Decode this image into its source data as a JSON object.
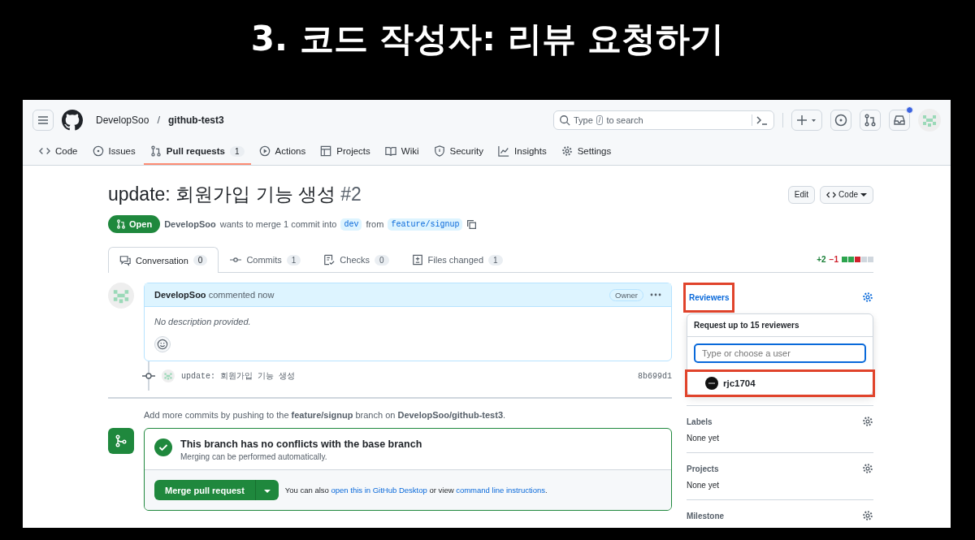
{
  "slide_title": "3. 코드 작성자: 리뷰 요청하기",
  "header": {
    "owner": "DevelopSoo",
    "separator": "/",
    "repo": "github-test3",
    "search_before": "Type",
    "search_key": "/",
    "search_after": "to search",
    "unread": true
  },
  "repo_tabs": [
    {
      "label": "Code",
      "selected": false
    },
    {
      "label": "Issues",
      "selected": false
    },
    {
      "label": "Pull requests",
      "count": "1",
      "selected": true
    },
    {
      "label": "Actions",
      "selected": false
    },
    {
      "label": "Projects",
      "selected": false
    },
    {
      "label": "Wiki",
      "selected": false
    },
    {
      "label": "Security",
      "selected": false
    },
    {
      "label": "Insights",
      "selected": false
    },
    {
      "label": "Settings",
      "selected": false
    }
  ],
  "pr": {
    "title": "update: 회원가입 기능 생성",
    "number": "#2",
    "state": "Open",
    "author": "DevelopSoo",
    "merge_text": "wants to merge 1 commit into",
    "base": "dev",
    "from": "from",
    "head": "feature/signup",
    "edit": "Edit",
    "code": "Code"
  },
  "pr_tabs": [
    {
      "label": "Conversation",
      "count": "0",
      "selected": true
    },
    {
      "label": "Commits",
      "count": "1",
      "selected": false
    },
    {
      "label": "Checks",
      "count": "0",
      "selected": false
    },
    {
      "label": "Files changed",
      "count": "1",
      "selected": false
    }
  ],
  "diffstat": {
    "added": "+2",
    "removed": "−1"
  },
  "comment": {
    "author": "DevelopSoo",
    "action": "commented now",
    "badge": "Owner",
    "body": "No description provided."
  },
  "commit": {
    "message": "update: 회원가입 기능 생성",
    "sha": "8b699d1"
  },
  "push_hint": "Add more commits by pushing to the **feature/signup** branch on **DevelopSoo/github-test3**.",
  "merge": {
    "title": "This branch has no conflicts with the base branch",
    "subtitle": "Merging can be performed automatically.",
    "button": "Merge pull request",
    "note_before": "You can also",
    "link1": "open this in GitHub Desktop",
    "note_middle": "or view",
    "link2": "command line instructions",
    "note_after": "."
  },
  "sidebar": {
    "reviewers": {
      "label": "Reviewers",
      "annotated": true,
      "popup_title": "Request up to 15 reviewers",
      "placeholder": "Type or choose a user",
      "users": [
        {
          "name": "rjc1704",
          "annotated": true
        }
      ]
    },
    "sections": [
      {
        "label": "Labels",
        "value": "None yet"
      },
      {
        "label": "Projects",
        "value": "None yet"
      },
      {
        "label": "Milestone"
      }
    ]
  }
}
